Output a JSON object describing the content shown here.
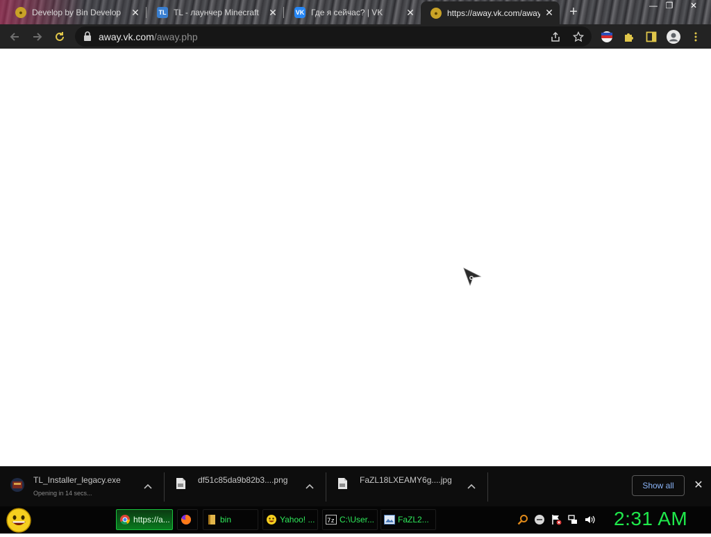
{
  "browser": {
    "tabs": [
      {
        "title": "Develop by Bin Develop",
        "favicon": "coin-icon"
      },
      {
        "title": "TL - лаунчер Minecraft",
        "favicon": "tl-launcher-icon"
      },
      {
        "title": "Где я сейчас? | VK",
        "favicon": "vk-icon"
      },
      {
        "title": "https://away.vk.com/away",
        "favicon": "coin-icon",
        "active": true
      }
    ],
    "new_tab_label": "+",
    "url_host": "away.vk.com",
    "url_path": "/away.php"
  },
  "downloads": {
    "items": [
      {
        "name": "TL_Installer_legacy.exe",
        "status": "Opening in 14 secs..."
      },
      {
        "name": "df51c85da9b82b3....png",
        "status": ""
      },
      {
        "name": "FaZL18LXEAMY6g....jpg",
        "status": ""
      }
    ],
    "show_all_label": "Show all"
  },
  "taskbar": {
    "tasks": [
      {
        "label": "https://a...",
        "icon": "chrome-icon",
        "active": true
      },
      {
        "label": "",
        "icon": "firefox-icon"
      },
      {
        "label": "bin",
        "icon": "folder-icon"
      },
      {
        "label": "Yahoo! ...",
        "icon": "yahoo-messenger-icon"
      },
      {
        "label": "C:\\User...",
        "icon": "console-icon"
      },
      {
        "label": "FaZL2...",
        "icon": "image-viewer-icon"
      }
    ],
    "clock": "2:31 AM"
  },
  "colors": {
    "taskbar_text": "#2ee85a",
    "clock": "#1fe84b",
    "show_all_text": "#8ab4f8"
  }
}
